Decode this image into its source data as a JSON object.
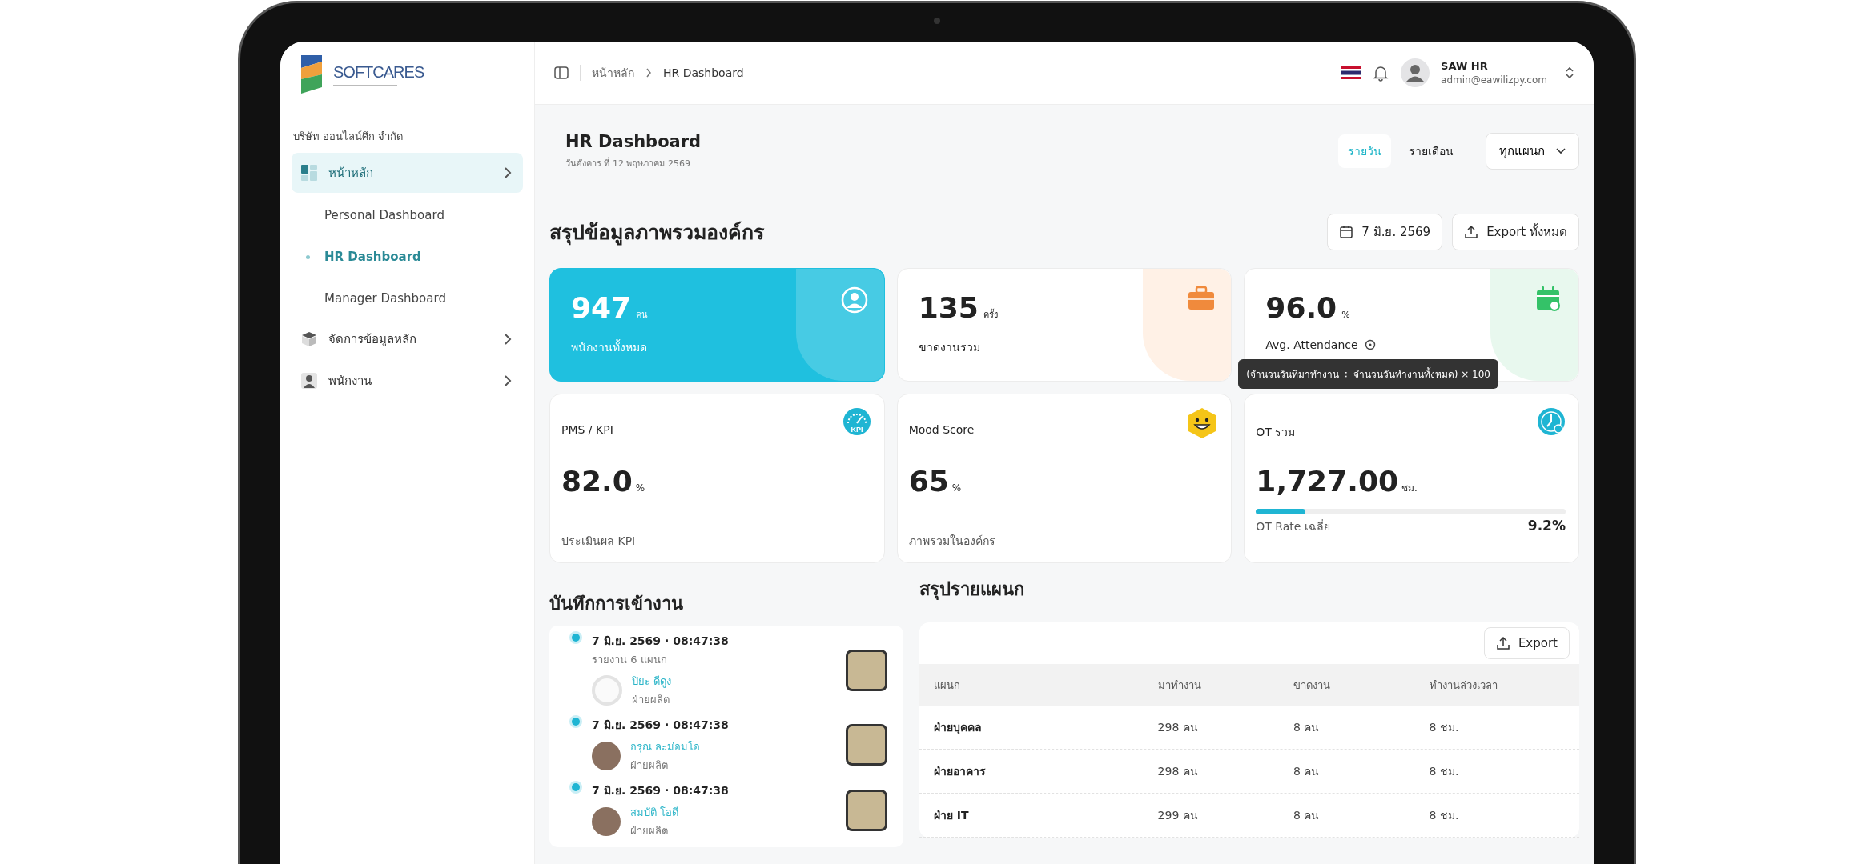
{
  "sidebar": {
    "logo_text": "SOFTCARES",
    "company": "บริษัท ออนไลน์ศึก จำกัด",
    "items": [
      {
        "label": "หน้าหลัก",
        "kind": "grid",
        "expanded": true,
        "selected": false,
        "children": [
          {
            "label": "Personal Dashboard",
            "selected": false
          },
          {
            "label": "HR Dashboard",
            "selected": true
          },
          {
            "label": "Manager Dashboard",
            "selected": false
          }
        ]
      },
      {
        "label": "จัดการข้อมูลหลัก",
        "kind": "box",
        "expanded": false,
        "selected": false
      },
      {
        "label": "พนักงาน",
        "kind": "person",
        "expanded": false,
        "selected": false
      }
    ]
  },
  "topbar": {
    "breadcrumb": [
      "หน้าหลัก",
      "HR Dashboard"
    ],
    "user_name": "SAW HR",
    "user_email": "admin@eawilizpy.com"
  },
  "header": {
    "title": "HR Dashboard",
    "subtitle": "วันอังคาร ที่ 12 พฤษภาคม 2569",
    "tabs": [
      {
        "label": "รายวัน",
        "selected": true
      },
      {
        "label": "รายเดือน",
        "selected": false
      }
    ],
    "department_select": "ทุกแผนก"
  },
  "overview": {
    "title": "สรุปข้อมูลภาพรวมองค์กร",
    "date_button": "7 มิ.ย. 2569",
    "export_button": "Export ทั้งหมด",
    "summary_cards": [
      {
        "kind": "people",
        "highlighted": true,
        "value": "947",
        "unit": "คน",
        "label": "พนักงานทั้งหมด"
      },
      {
        "kind": "briefcase",
        "highlighted": false,
        "value": "135",
        "unit": "ครั้ง",
        "label": "ขาดงานรวม"
      },
      {
        "kind": "calendar",
        "highlighted": false,
        "value": "96.0",
        "unit": "%",
        "label": "Avg. Attendance",
        "tooltip": "(จำนวนวันที่มาทำงาน ÷ จำนวนวันทำงานทั้งหมด) × 100"
      }
    ],
    "metric_cards": [
      {
        "kind": "gauge",
        "icon_text": "KPI",
        "title": "PMS / KPI",
        "value": "82.0",
        "unit": "%",
        "caption": "ประเมินผล KPI"
      },
      {
        "kind": "smile",
        "title": "Mood Score",
        "value": "65",
        "unit": "%",
        "caption": "ภาพรวมในองค์กร"
      },
      {
        "kind": "clock",
        "title": "OT รวม",
        "value": "1,727.00",
        "unit": "ชม.",
        "level": 0.16,
        "rate_label": "OT Rate เฉลี่ย",
        "rate": "9.2%"
      }
    ]
  },
  "attendance": {
    "title": "บันทึกการเข้างาน",
    "entries": [
      {
        "datetime": "7 มิ.ย. 2569 · 08:47:38",
        "note": "รายงาน 6 แผนก",
        "name": "ปิยะ ดีดูง",
        "department": "ฝ่ายผลิต",
        "kind": "silhouette"
      },
      {
        "datetime": "7 มิ.ย. 2569 · 08:47:38",
        "name": "อรุณ ละม่อมโอ",
        "department": "ฝ่ายผลิต",
        "kind": "photo"
      },
      {
        "datetime": "7 มิ.ย. 2569 · 08:47:38",
        "name": "สมบัติ โอดี",
        "department": "ฝ่ายผลิต",
        "kind": "photo"
      }
    ]
  },
  "departments": {
    "title": "สรุปรายแผนก",
    "export_button": "Export",
    "columns": [
      "แผนก",
      "มาทำงาน",
      "ขาดงาน",
      "ทำงานล่วงเวลา"
    ],
    "rows": [
      [
        "ฝ่ายบุคคล",
        "298 คน",
        "8 คน",
        "8 ชม."
      ],
      [
        "ฝ่ายอาคาร",
        "298 คน",
        "8 คน",
        "8 ชม."
      ],
      [
        "ฝ่าย IT",
        "299 คน",
        "8 คน",
        "8 ชม."
      ]
    ]
  }
}
